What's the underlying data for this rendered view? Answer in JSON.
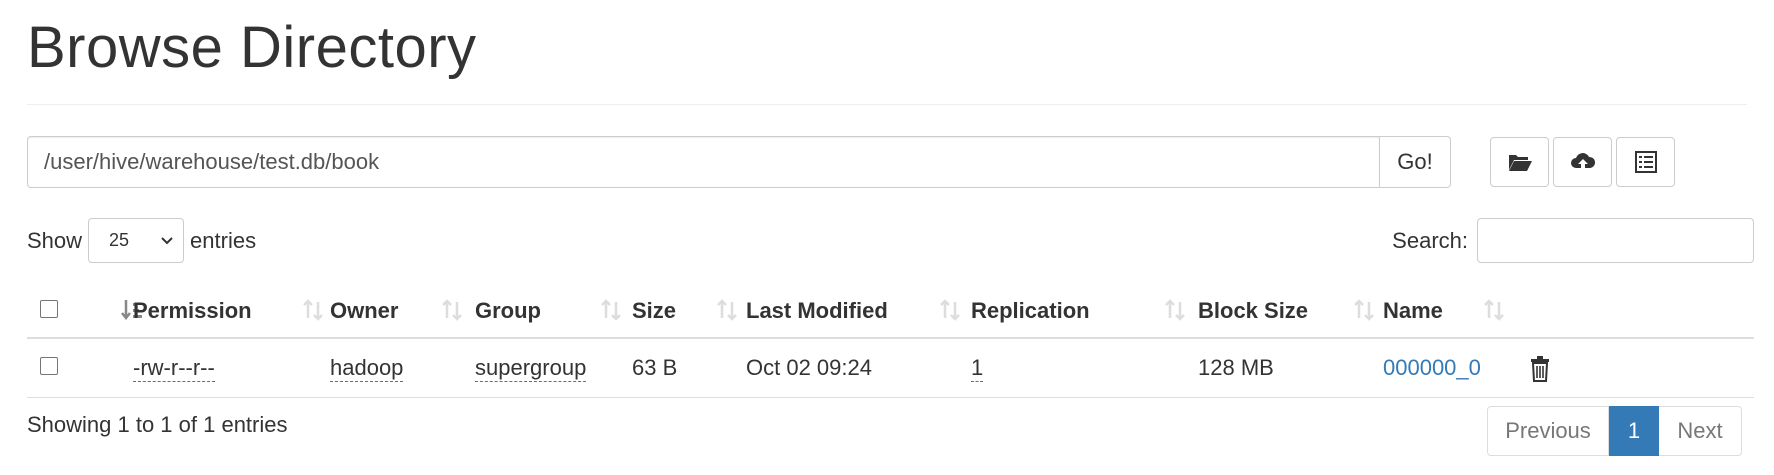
{
  "page": {
    "title": "Browse Directory"
  },
  "path_bar": {
    "value": "/user/hive/warehouse/test.db/book",
    "go_label": "Go!"
  },
  "toolbar": {
    "icons": [
      "folder-open-icon",
      "cloud-upload-icon",
      "list-alt-icon"
    ]
  },
  "length": {
    "show_label": "Show",
    "selected": "25",
    "entries_label": "entries"
  },
  "search": {
    "label": "Search:",
    "value": ""
  },
  "table": {
    "columns": [
      "Permission",
      "Owner",
      "Group",
      "Size",
      "Last Modified",
      "Replication",
      "Block Size",
      "Name"
    ],
    "rows": [
      {
        "permission": "-rw-r--r--",
        "owner": "hadoop",
        "group": "supergroup",
        "size": "63 B",
        "last_modified": "Oct 02 09:24",
        "replication": "1",
        "block_size": "128 MB",
        "name": "000000_0"
      }
    ]
  },
  "info": "Showing 1 to 1 of 1 entries",
  "pagination": {
    "previous": "Previous",
    "current": "1",
    "next": "Next"
  },
  "colors": {
    "link": "#337ab7",
    "active_page": "#337ab7",
    "border": "#dddddd"
  }
}
